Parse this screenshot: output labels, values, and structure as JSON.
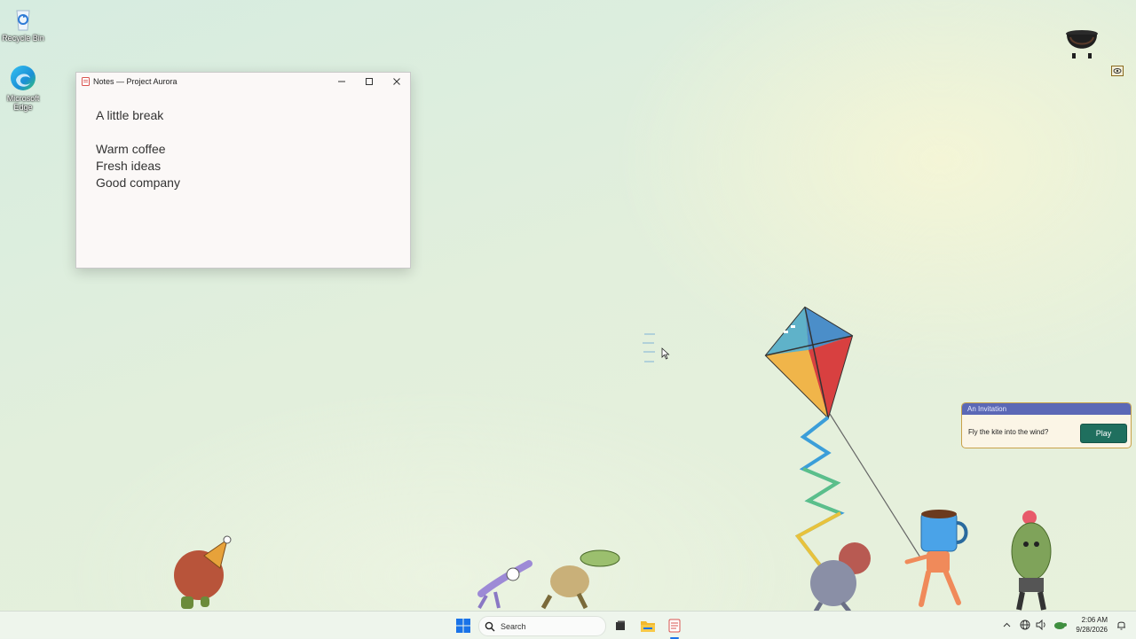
{
  "desktop": {
    "icons": [
      {
        "label": "Recycle Bin"
      },
      {
        "label": "Microsoft Edge"
      }
    ]
  },
  "notes_window": {
    "title": "Notes — Project Aurora",
    "lines": [
      "A little break",
      "",
      "Warm coffee",
      "Fresh ideas",
      "Good company"
    ]
  },
  "invitation": {
    "header": "An Invitation",
    "message": "Fly the kite into the wind?",
    "button": "Play"
  },
  "taskbar": {
    "search_placeholder": "Search",
    "time": "2:06 AM",
    "date": "9/28/2026"
  },
  "icons": {
    "start": "windows-start-icon",
    "search": "search-icon",
    "task_view": "task-view-icon",
    "explorer": "file-explorer-icon",
    "notes": "notes-app-icon"
  },
  "colors": {
    "invite_header": "#5b68b6",
    "play_button": "#1f6f5e",
    "invite_border": "#c8a24a"
  }
}
